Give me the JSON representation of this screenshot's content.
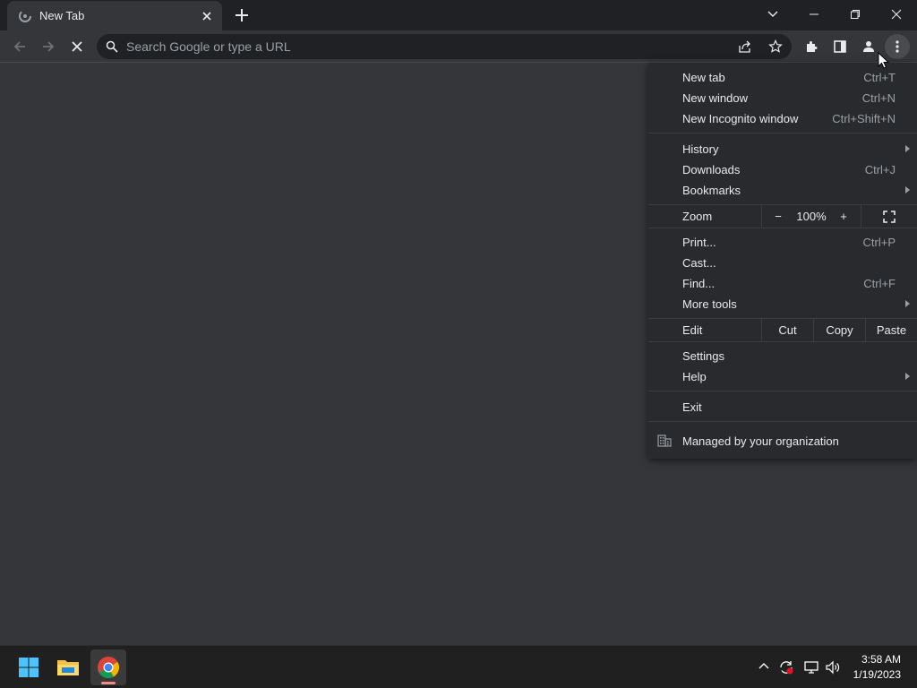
{
  "browser": {
    "tab": {
      "title": "New Tab"
    },
    "omnibox": {
      "placeholder": "Search Google or type a URL"
    }
  },
  "menu": {
    "group1": [
      {
        "label": "New tab",
        "shortcut": "Ctrl+T"
      },
      {
        "label": "New window",
        "shortcut": "Ctrl+N"
      },
      {
        "label": "New Incognito window",
        "shortcut": "Ctrl+Shift+N"
      }
    ],
    "group2": [
      {
        "label": "History",
        "shortcut": ""
      },
      {
        "label": "Downloads",
        "shortcut": "Ctrl+J"
      },
      {
        "label": "Bookmarks",
        "shortcut": ""
      }
    ],
    "zoom": {
      "label": "Zoom",
      "minus": "−",
      "value": "100%",
      "plus": "+"
    },
    "group3": [
      {
        "label": "Print...",
        "shortcut": "Ctrl+P"
      },
      {
        "label": "Cast...",
        "shortcut": ""
      },
      {
        "label": "Find...",
        "shortcut": "Ctrl+F"
      },
      {
        "label": "More tools",
        "shortcut": ""
      }
    ],
    "edit": {
      "label": "Edit",
      "cut": "Cut",
      "copy": "Copy",
      "paste": "Paste"
    },
    "group4": [
      {
        "label": "Settings"
      },
      {
        "label": "Help"
      }
    ],
    "exit": "Exit",
    "managed": "Managed by your organization"
  },
  "taskbar": {
    "time": "3:58 AM",
    "date": "1/19/2023"
  },
  "colors": {
    "page_bg": "#35363a",
    "titlebar_bg": "#202124",
    "menu_bg": "#292a2d",
    "taskbar_bg": "#202020",
    "windows_blue": "#4cc2ff"
  }
}
